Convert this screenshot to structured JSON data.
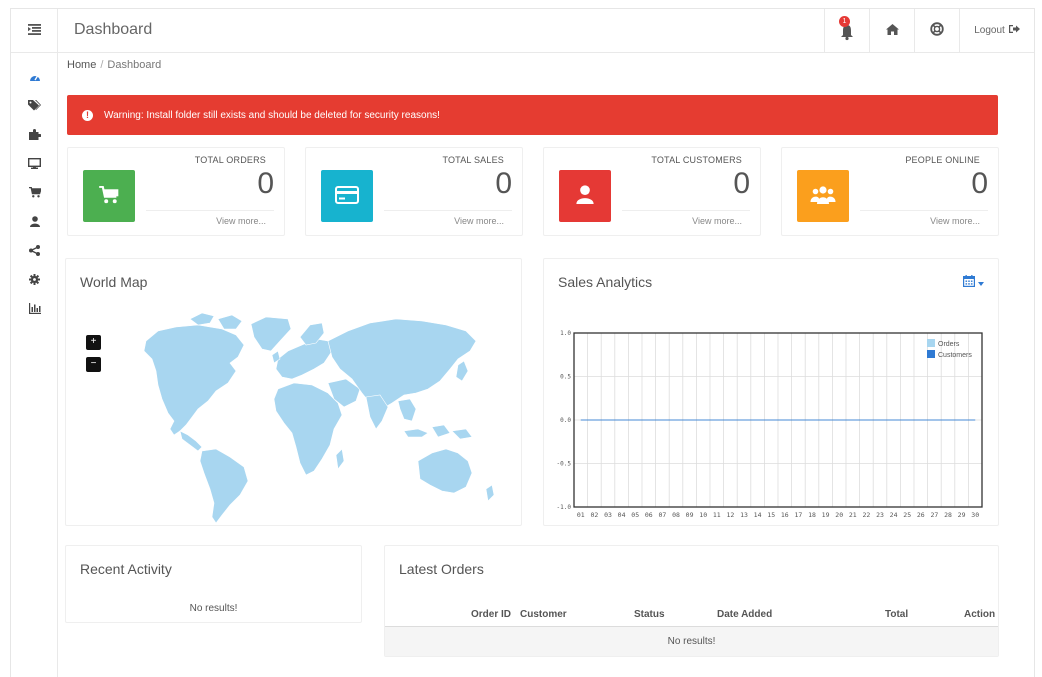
{
  "header": {
    "title": "Dashboard",
    "notification_count": "1",
    "logout_label": "Logout"
  },
  "sidebar": {
    "items": [
      {
        "icon": "dashboard-icon"
      },
      {
        "icon": "tags-icon"
      },
      {
        "icon": "puzzle-icon"
      },
      {
        "icon": "desktop-icon"
      },
      {
        "icon": "cart-icon"
      },
      {
        "icon": "user-icon"
      },
      {
        "icon": "share-icon"
      },
      {
        "icon": "cog-icon"
      },
      {
        "icon": "bar-chart-icon"
      }
    ]
  },
  "breadcrumb": {
    "home": "Home",
    "separator": "/",
    "current": "Dashboard"
  },
  "alert": {
    "text": "Warning: Install folder still exists and should be deleted for security reasons!",
    "color": "#e53c31"
  },
  "stats": [
    {
      "label": "TOTAL ORDERS",
      "value": "0",
      "more": "View more...",
      "color": "#4caf50",
      "icon": "cart-icon"
    },
    {
      "label": "TOTAL SALES",
      "value": "0",
      "more": "View more...",
      "color": "#17b3cf",
      "icon": "credit-card-icon"
    },
    {
      "label": "TOTAL CUSTOMERS",
      "value": "0",
      "more": "View more...",
      "color": "#e53935",
      "icon": "user-icon"
    },
    {
      "label": "PEOPLE ONLINE",
      "value": "0",
      "more": "View more...",
      "color": "#fb9f1d",
      "icon": "users-icon"
    }
  ],
  "world_map": {
    "title": "World Map",
    "zoom_in": "+",
    "zoom_out": "−",
    "land_color": "#a8d6f0"
  },
  "sales": {
    "title": "Sales Analytics"
  },
  "chart_data": {
    "type": "line",
    "x": [
      "01",
      "02",
      "03",
      "04",
      "05",
      "06",
      "07",
      "08",
      "09",
      "10",
      "11",
      "12",
      "13",
      "14",
      "15",
      "16",
      "17",
      "18",
      "19",
      "20",
      "21",
      "22",
      "23",
      "24",
      "25",
      "26",
      "27",
      "28",
      "29",
      "30"
    ],
    "series": [
      {
        "name": "Orders",
        "color": "#a8d6f0",
        "values": [
          0,
          0,
          0,
          0,
          0,
          0,
          0,
          0,
          0,
          0,
          0,
          0,
          0,
          0,
          0,
          0,
          0,
          0,
          0,
          0,
          0,
          0,
          0,
          0,
          0,
          0,
          0,
          0,
          0,
          0
        ]
      },
      {
        "name": "Customers",
        "color": "#2f7ad3",
        "values": [
          0,
          0,
          0,
          0,
          0,
          0,
          0,
          0,
          0,
          0,
          0,
          0,
          0,
          0,
          0,
          0,
          0,
          0,
          0,
          0,
          0,
          0,
          0,
          0,
          0,
          0,
          0,
          0,
          0,
          0
        ]
      }
    ],
    "yticks": [
      "1.0",
      "0.5",
      "0.0",
      "-0.5",
      "-1.0"
    ],
    "ylim": [
      -1,
      1
    ],
    "grid": true,
    "legend_position": "top-right"
  },
  "activity": {
    "title": "Recent Activity",
    "empty": "No results!"
  },
  "orders": {
    "title": "Latest Orders",
    "columns": [
      "Order ID",
      "Customer",
      "Status",
      "Date Added",
      "Total",
      "Action"
    ],
    "empty": "No results!"
  }
}
